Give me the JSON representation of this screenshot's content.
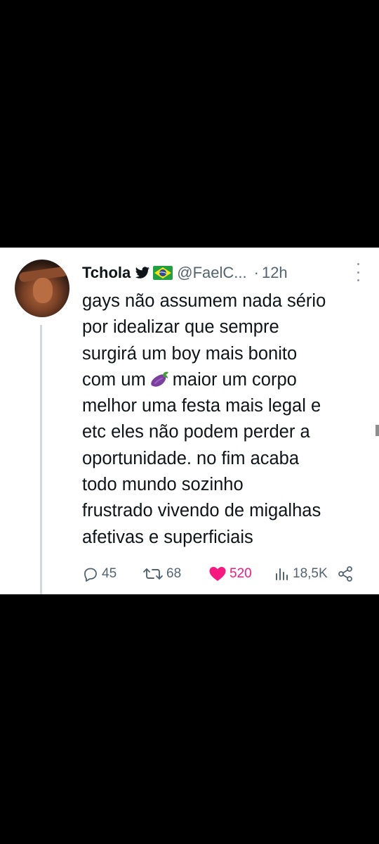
{
  "tweet": {
    "author_name": "Tchola",
    "handle": "@FaelC...",
    "separator": "·",
    "time": "12h",
    "lines": [
      "gays não assumem nada sério",
      "por idealizar que sempre",
      "surgirá um boy mais bonito",
      "maior um corpo",
      "melhor uma festa mais legal e",
      "etc eles não podem perder a",
      "oportunidade. no fim acaba",
      "todo mundo sozinho",
      "frustrado vivendo de migalhas",
      "afetivas e superficiais"
    ],
    "line4_prefix": "com um",
    "emoji": "eggplant-emoji",
    "icons": {
      "author_badge": "bird-icon",
      "flag": "brazil-flag-icon",
      "more": "more-vertical-icon"
    }
  },
  "actions": {
    "replies": "45",
    "retweets": "68",
    "likes": "520",
    "views": "18,5K",
    "icons": [
      "reply-icon",
      "retweet-icon",
      "heart-icon",
      "views-icon",
      "share-icon"
    ]
  },
  "colors": {
    "like": "#f91880",
    "muted": "#536471",
    "text": "#0f1419"
  }
}
